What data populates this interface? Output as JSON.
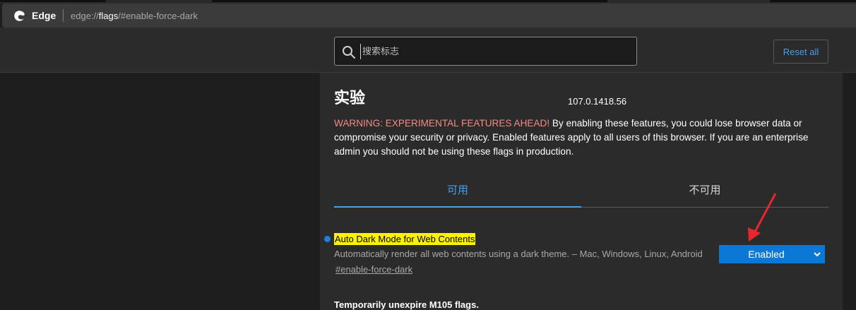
{
  "browser": {
    "site_name": "Edge",
    "url_prefix": "edge://",
    "url_host": "flags",
    "url_suffix": "/#enable-force-dark"
  },
  "header": {
    "search_placeholder": "搜索标志",
    "reset_label": "Reset all"
  },
  "page": {
    "title": "实验",
    "version": "107.0.1418.56",
    "warning_head": "WARNING: EXPERIMENTAL FEATURES AHEAD!",
    "warning_body": " By enabling these features, you could lose browser data or compromise your security or privacy. Enabled features apply to all users of this browser. If you are an enterprise admin you should not be using these flags in production."
  },
  "tabs": [
    {
      "label": "可用"
    },
    {
      "label": "不可用"
    }
  ],
  "flags": [
    {
      "name": "Auto Dark Mode for Web Contents",
      "description": "Automatically render all web contents using a dark theme. – Mac, Windows, Linux, Android",
      "link": "#enable-force-dark",
      "value": "Enabled"
    },
    {
      "name": "Temporarily unexpire M105 flags."
    }
  ],
  "colors": {
    "accent": "#4a9ee8",
    "warning": "#f28b82",
    "highlight": "#fff200",
    "select_bg": "#0a78d4",
    "annotation": "#e8262c"
  },
  "icons": {
    "browser_logo": "edge-logo-icon",
    "search": "search-icon",
    "dropdown": "chevron-down-icon"
  }
}
